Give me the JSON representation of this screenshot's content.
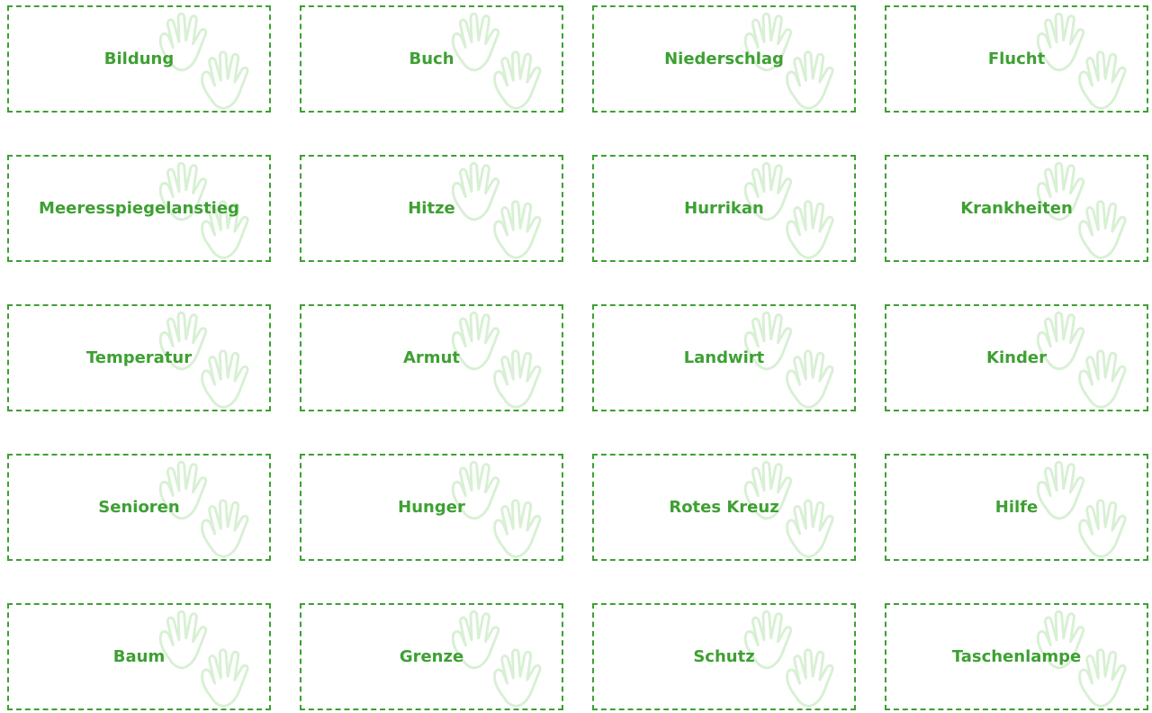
{
  "theme": {
    "accent_color": "#3ea033",
    "hand_color": "#d8f0d4",
    "decoration_icon": "hands-icon"
  },
  "cards": [
    {
      "label": "Bildung"
    },
    {
      "label": "Buch"
    },
    {
      "label": "Niederschlag"
    },
    {
      "label": "Flucht"
    },
    {
      "label": "Meeresspiegelanstieg"
    },
    {
      "label": "Hitze"
    },
    {
      "label": "Hurrikan"
    },
    {
      "label": "Krankheiten"
    },
    {
      "label": "Temperatur"
    },
    {
      "label": "Armut"
    },
    {
      "label": "Landwirt"
    },
    {
      "label": "Kinder"
    },
    {
      "label": "Senioren"
    },
    {
      "label": "Hunger"
    },
    {
      "label": "Rotes Kreuz"
    },
    {
      "label": "Hilfe"
    },
    {
      "label": "Baum"
    },
    {
      "label": "Grenze"
    },
    {
      "label": "Schutz"
    },
    {
      "label": "Taschenlampe"
    }
  ]
}
